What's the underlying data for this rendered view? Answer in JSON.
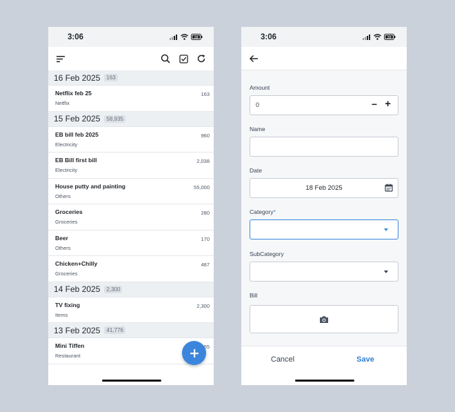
{
  "status_bar": {
    "time": "3:06",
    "battery": "28"
  },
  "list_screen": {
    "groups": [
      {
        "date": "16 Feb 2025",
        "total": "163",
        "items": [
          {
            "name": "Netflix feb 25",
            "category": "Netflix",
            "amount": "163"
          }
        ]
      },
      {
        "date": "15 Feb 2025",
        "total": "58,935",
        "items": [
          {
            "name": "EB bill feb 2025",
            "category": "Electricity",
            "amount": "960"
          },
          {
            "name": "EB Bill first bill",
            "category": "Electricity",
            "amount": "2,038"
          },
          {
            "name": "House putty and painting",
            "category": "Others",
            "amount": "55,000"
          },
          {
            "name": "Groceries",
            "category": "Groceries",
            "amount": "280"
          },
          {
            "name": "Beer",
            "category": "Others",
            "amount": "170"
          },
          {
            "name": "Chicken+Chilly",
            "category": "Groceries",
            "amount": "487"
          }
        ]
      },
      {
        "date": "14 Feb 2025",
        "total": "2,300",
        "items": [
          {
            "name": "TV fixing",
            "category": "Items",
            "amount": "2,300"
          }
        ]
      },
      {
        "date": "13 Feb 2025",
        "total": "41,776",
        "items": [
          {
            "name": "Mini Tiffen",
            "category": "Restaurant",
            "amount": "65"
          }
        ]
      }
    ]
  },
  "form_screen": {
    "amount_label": "Amount",
    "amount_value": "0",
    "minus_label": "−",
    "plus_label": "+",
    "name_label": "Name",
    "name_value": "",
    "date_label": "Date",
    "date_value": "18 Feb 2025",
    "category_label": "Category",
    "required_marker": "*",
    "subcategory_label": "SubCategory",
    "bill_label": "Bill",
    "cancel_label": "Cancel",
    "save_label": "Save"
  },
  "colors": {
    "accent": "#3b86dc",
    "background": "#cbd1da"
  },
  "icons": [
    "menu-icon",
    "search-icon",
    "checkbox-icon",
    "refresh-icon",
    "plus-icon",
    "back-arrow-icon",
    "calendar-icon",
    "dropdown-caret-icon",
    "camera-icon",
    "signal-icon",
    "wifi-icon",
    "battery-icon"
  ]
}
